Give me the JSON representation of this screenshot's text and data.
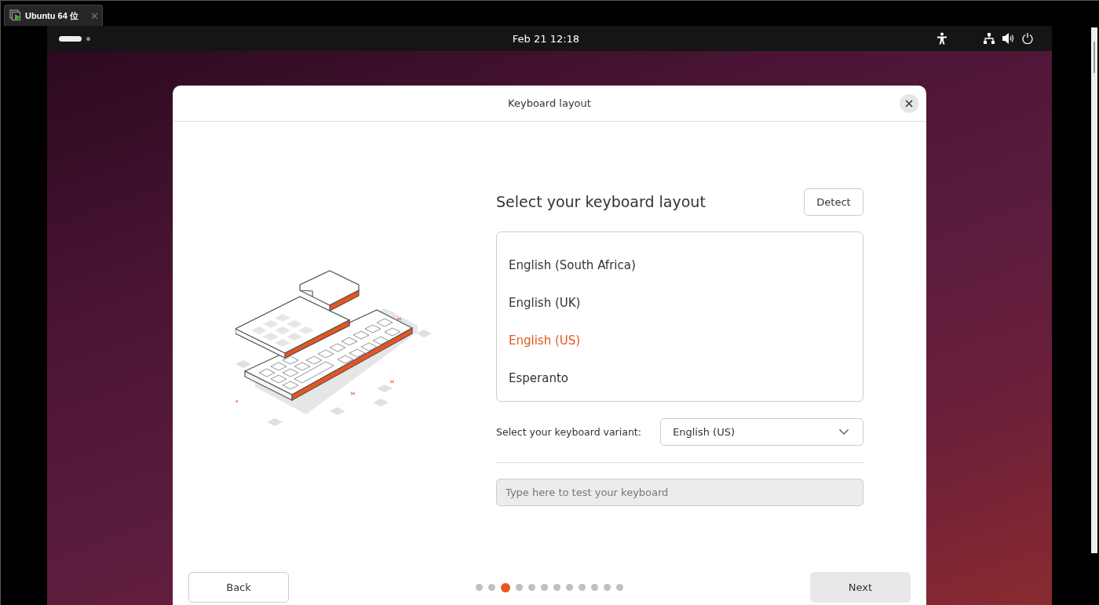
{
  "vm_tab": {
    "title": "Ubuntu 64 位",
    "close": "✕"
  },
  "top_bar": {
    "clock": "Feb 21  12:18"
  },
  "dialog": {
    "title": "Keyboard layout",
    "heading": "Select your keyboard layout",
    "detect_button": "Detect",
    "layouts": [
      {
        "label": "English (South Africa)",
        "selected": false
      },
      {
        "label": "English (UK)",
        "selected": false
      },
      {
        "label": "English (US)",
        "selected": true
      },
      {
        "label": "Esperanto",
        "selected": false
      }
    ],
    "variant_label": "Select your keyboard variant:",
    "variant_value": "English (US)",
    "test_field": {
      "placeholder": "Type here to test your keyboard"
    },
    "back_button": "Back",
    "next_button": "Next",
    "steps": [
      {
        "selected": false
      },
      {
        "selected": false
      },
      {
        "selected": true
      },
      {
        "selected": false
      },
      {
        "selected": false
      },
      {
        "selected": false
      },
      {
        "selected": false
      },
      {
        "selected": false
      },
      {
        "selected": false
      },
      {
        "selected": false
      },
      {
        "selected": false
      },
      {
        "selected": false
      }
    ]
  }
}
